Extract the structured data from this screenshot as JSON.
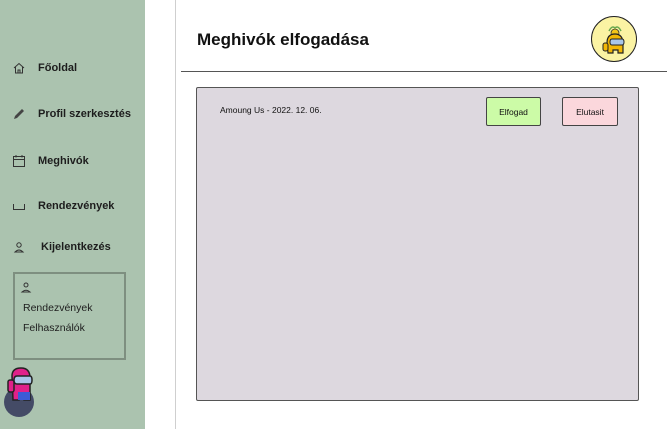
{
  "sidebar": {
    "items": [
      {
        "id": "home",
        "label": "Főoldal",
        "icon": "home-icon"
      },
      {
        "id": "profile",
        "label": "Profil szerkesztés",
        "icon": "pencil-icon"
      },
      {
        "id": "invites",
        "label": "Meghivók",
        "icon": "calendar-icon"
      },
      {
        "id": "events",
        "label": "Rendezvények",
        "icon": "tray-icon"
      },
      {
        "id": "logout",
        "label": "Kijelentkezés",
        "icon": "user-icon"
      }
    ],
    "admin": {
      "icon": "user-icon",
      "links": [
        "Rendezvények",
        "Felhasználók"
      ]
    }
  },
  "header": {
    "title": "Meghivók elfogadása"
  },
  "invites": [
    {
      "text": "Amoung Us -  2022. 12. 06.",
      "accept_label": "Elfogad",
      "reject_label": "Elutasit"
    }
  ],
  "colors": {
    "sidebar": "#abc3af",
    "panel": "#ddd8df",
    "accept": "#ccfba7",
    "reject": "#fbd7dc",
    "badge": "#fbf3a3"
  }
}
